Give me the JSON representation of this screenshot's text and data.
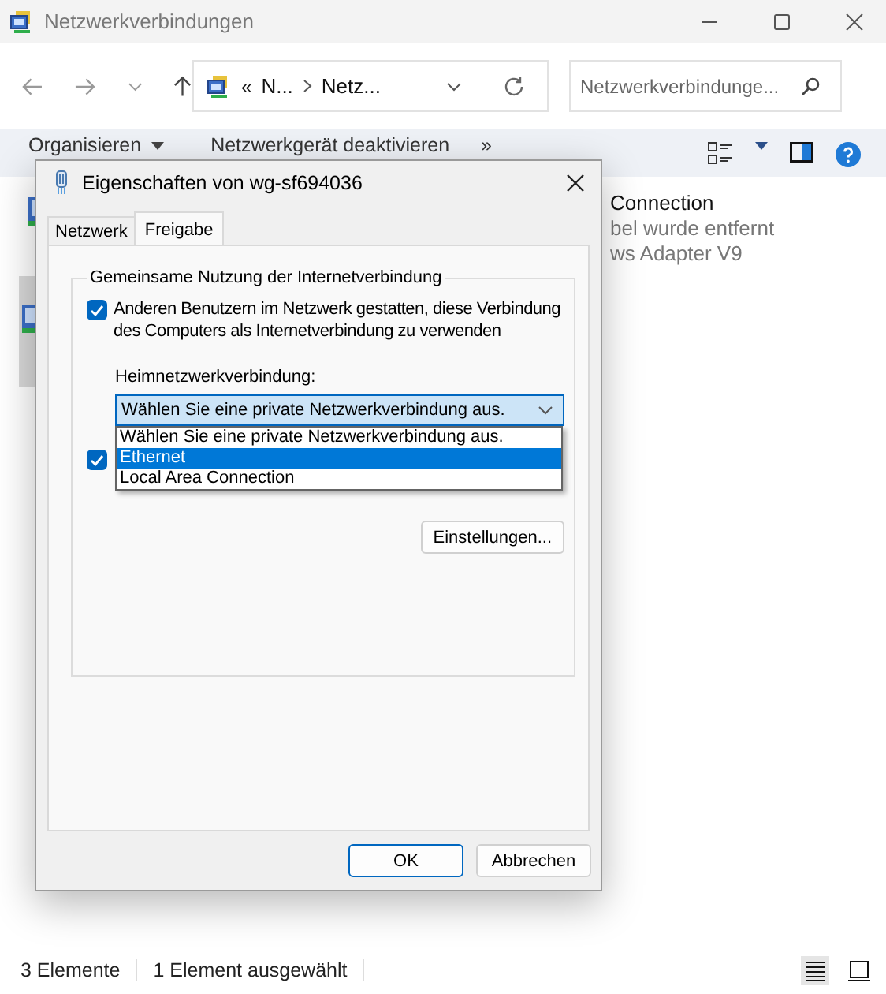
{
  "window": {
    "title": "Netzwerkverbindungen"
  },
  "address": {
    "overflow": "«",
    "path": [
      "N...",
      "Netz..."
    ]
  },
  "search": {
    "placeholder": "Netzwerkverbindunge..."
  },
  "commands": [
    {
      "label": "Organisieren",
      "kind": "menu"
    },
    {
      "label": "Netzwerkgerät deaktivieren",
      "kind": "button"
    },
    {
      "label": "»",
      "kind": "more"
    }
  ],
  "items": [
    {
      "selected": false,
      "name": "Connection",
      "status": "bel wurde entfernt",
      "device": "ws Adapter V9"
    },
    {
      "selected": true
    }
  ],
  "status_bar": {
    "count": "3 Elemente",
    "selection": "1 Element ausgewählt",
    "views": [
      {
        "kind": "details",
        "selected": true
      },
      {
        "kind": "tiles",
        "selected": false
      }
    ]
  },
  "dialog": {
    "title": "Eigenschaften von wg-sf694036",
    "tabs": [
      {
        "label": "Netzwerk",
        "selected": false
      },
      {
        "label": "Freigabe",
        "selected": true
      }
    ],
    "sharing": {
      "legend": "Gemeinsame Nutzung der Internetverbindung",
      "allow": {
        "label": "Anderen Benutzern im Netzwerk gestatten, diese Verbindung des Computers als Internetverbindung zu verwenden",
        "checked": true
      },
      "home_network": {
        "label": "Heimnetzwerkverbindung:",
        "value": "Wählen Sie eine private Netzwerkverbindung aus.",
        "expanded": true,
        "options": [
          {
            "label": "Wählen Sie eine private Netzwerkverbindung aus.",
            "highlighted": false
          },
          {
            "label": "Ethernet",
            "highlighted": true
          },
          {
            "label": "Local Area Connection",
            "highlighted": false
          }
        ]
      },
      "control": {
        "checked": true
      },
      "settings_button": "Einstellungen..."
    },
    "buttons": [
      {
        "label": "OK",
        "default": true
      },
      {
        "label": "Abbrechen",
        "default": false
      }
    ]
  }
}
